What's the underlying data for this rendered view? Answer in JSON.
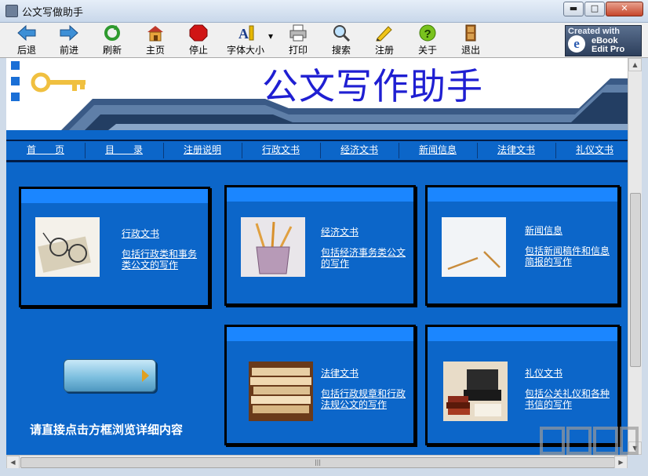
{
  "window": {
    "title": "公文写做助手",
    "min_label": "▬",
    "max_label": "□",
    "close_label": "✕"
  },
  "toolbar": {
    "buttons": [
      {
        "label": "后退",
        "icon": "back-arrow-icon"
      },
      {
        "label": "前进",
        "icon": "forward-arrow-icon"
      },
      {
        "label": "刷新",
        "icon": "refresh-icon"
      },
      {
        "label": "主页",
        "icon": "home-icon"
      },
      {
        "label": "停止",
        "icon": "stop-icon"
      },
      {
        "label": "字体大小",
        "icon": "font-size-icon"
      },
      {
        "label": "打印",
        "icon": "printer-icon"
      },
      {
        "label": "搜索",
        "icon": "magnifier-icon"
      },
      {
        "label": "注册",
        "icon": "pencil-icon"
      },
      {
        "label": "关于",
        "icon": "help-icon"
      },
      {
        "label": "退出",
        "icon": "exit-door-icon"
      }
    ],
    "font_dropdown": "▾",
    "logo": {
      "line1": "Created with",
      "e": "e",
      "line2": "eBook",
      "line3": "Edit Pro"
    }
  },
  "banner": {
    "title": "公文写作助手"
  },
  "nav": [
    "首　　页",
    "目　　录",
    "注册说明",
    "行政文书",
    "经济文书",
    "新闻信息",
    "法律文书",
    "礼仪文书"
  ],
  "cards": [
    {
      "title": "行政文书",
      "desc": "包括行政类和事务类公文的写作",
      "image": "eyeglasses-image"
    },
    {
      "title": "经济文书",
      "desc": "包括经济事务类公文的写作",
      "image": "pencil-cup-image"
    },
    {
      "title": "新闻信息",
      "desc": "包括新闻稿件和信息简报的写作",
      "image": "pencil-on-paper-image"
    },
    {
      "title": "法律文书",
      "desc": "包括行政规章和行政法规公文的写作",
      "image": "document-stack-image"
    },
    {
      "title": "礼仪文书",
      "desc": "包括公关礼仪和各种书信的写作",
      "image": "typewriter-books-image"
    }
  ],
  "hint": "请直接点击方框浏览详细内容",
  "scrollbar": {
    "up": "▲",
    "down": "▼",
    "left": "◀",
    "right": "▶",
    "grip": "|||"
  },
  "colors": {
    "page_bg": "#0c66c9",
    "card_top": "#1b86ff",
    "title_blue": "#1f1fd2"
  }
}
